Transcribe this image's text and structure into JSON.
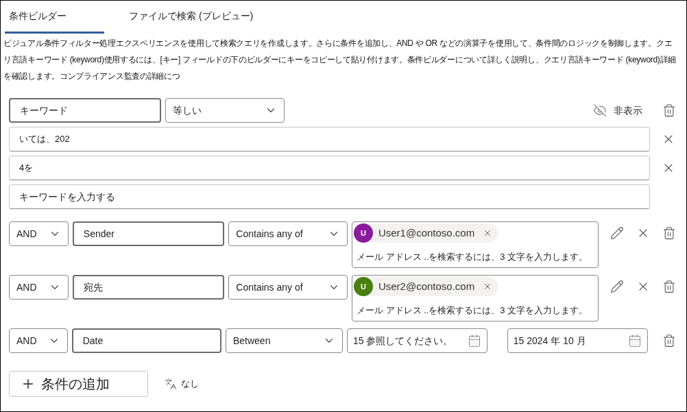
{
  "tabs": [
    {
      "label": "条件ビルダー",
      "selected": true
    },
    {
      "label": "ファイルで検索 (プレビュー)",
      "selected": false
    }
  ],
  "description": "ビジュアル条件フィルター処理エクスペリエンスを使用して検索クエリを作成します。さらに条件を追加し、AND や OR などの演算子を使用して、条件間のロジックを制御します。クエリ言語キーワード (keyword)使用するには、[キー] フィールドの下のビルダーにキーをコピーして貼り付けます。条件ビルダーについて詳しく説明し、クエリ言語キーワード (keyword)詳細を確認します。コンプライアンス監査の詳細につ",
  "keyword_group": {
    "field": "キーワード",
    "operator": "等しい",
    "hide_label": "非表示",
    "values": [
      {
        "text": "いては、202"
      },
      {
        "text": "4を"
      }
    ],
    "input_placeholder": "キーワードを入力する"
  },
  "conditions": [
    {
      "kind": "people",
      "connector": "AND",
      "field": "Sender",
      "operator": "Contains any of",
      "chips": [
        {
          "initial": "U",
          "email": "User1@contoso.com",
          "color": "#8a1b9c"
        }
      ],
      "hint": "メール アドレス ..を検索するには、3 文字を入力します。"
    },
    {
      "kind": "people",
      "connector": "AND",
      "field": "宛先",
      "operator": "Contains any of",
      "chips": [
        {
          "initial": "U",
          "email": "User2@contoso.com",
          "color": "#4b7f12"
        }
      ],
      "hint": "メール アドレス ..を検索するには、3 文字を入力します。"
    },
    {
      "kind": "date",
      "connector": "AND",
      "field": "Date",
      "operator": "Between",
      "from": "15 参照してください。",
      "to": "15 2024 年 10 月"
    }
  ],
  "footer": {
    "add_label": "条件の追加",
    "language": "なし"
  }
}
